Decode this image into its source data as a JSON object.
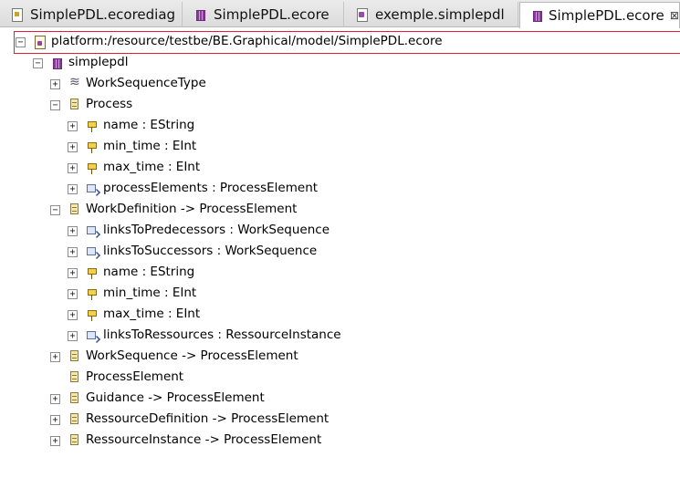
{
  "tabs": [
    {
      "label": "SimplePDL.ecorediag",
      "icon": "diagram-file-icon"
    },
    {
      "label": "SimplePDL.ecore",
      "icon": "ecore-file-icon"
    },
    {
      "label": "exemple.simplepdl",
      "icon": "model-file-icon"
    },
    {
      "label": "SimplePDL.ecore",
      "icon": "ecore-file-icon",
      "active": true,
      "close": "⊠"
    }
  ],
  "tree": {
    "resource": "platform:/resource/testbe/BE.Graphical/model/SimplePDL.ecore",
    "package": "simplepdl",
    "items": [
      {
        "label": "WorkSequenceType",
        "kind": "enum",
        "expander": "+"
      },
      {
        "label": "Process",
        "kind": "class",
        "expander": "−"
      },
      {
        "label": "name : EString",
        "kind": "attribute",
        "expander": "+"
      },
      {
        "label": "min_time : EInt",
        "kind": "attribute",
        "expander": "+"
      },
      {
        "label": "max_time : EInt",
        "kind": "attribute",
        "expander": "+"
      },
      {
        "label": "processElements : ProcessElement",
        "kind": "reference",
        "expander": "+"
      },
      {
        "label": "WorkDefinition -> ProcessElement",
        "kind": "class",
        "expander": "−"
      },
      {
        "label": "linksToPredecessors : WorkSequence",
        "kind": "reference",
        "expander": "+"
      },
      {
        "label": "linksToSuccessors : WorkSequence",
        "kind": "reference",
        "expander": "+"
      },
      {
        "label": "name : EString",
        "kind": "attribute",
        "expander": "+"
      },
      {
        "label": "min_time : EInt",
        "kind": "attribute",
        "expander": "+"
      },
      {
        "label": "max_time : EInt",
        "kind": "attribute",
        "expander": "+"
      },
      {
        "label": "linksToRessources : RessourceInstance",
        "kind": "reference",
        "expander": "+"
      },
      {
        "label": "WorkSequence -> ProcessElement",
        "kind": "class",
        "expander": "+"
      },
      {
        "label": "ProcessElement",
        "kind": "class",
        "expander": ""
      },
      {
        "label": "Guidance -> ProcessElement",
        "kind": "class",
        "expander": "+"
      },
      {
        "label": "RessourceDefinition -> ProcessElement",
        "kind": "class",
        "expander": "+"
      },
      {
        "label": "RessourceInstance -> ProcessElement",
        "kind": "class",
        "expander": "+"
      }
    ]
  },
  "expander_symbols": {
    "collapsed": "+",
    "expanded": "−"
  }
}
